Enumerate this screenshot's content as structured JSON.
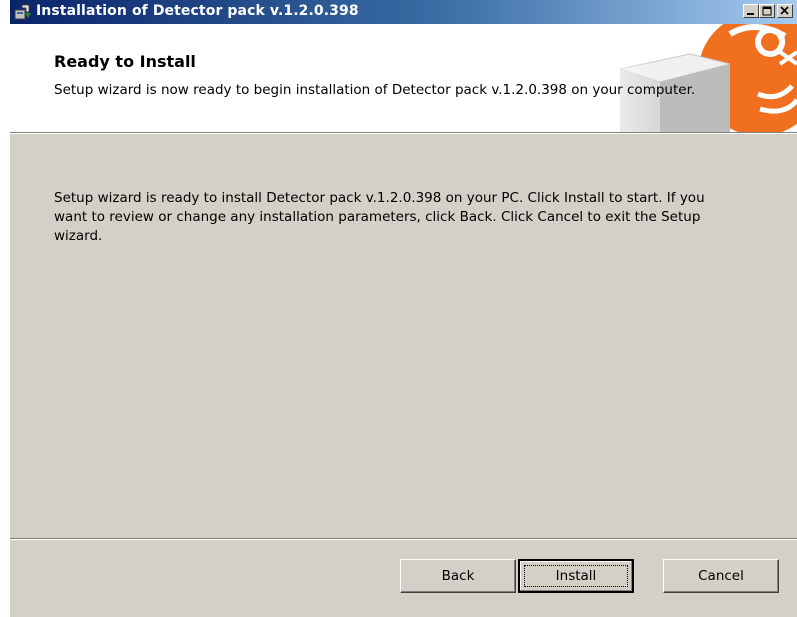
{
  "window": {
    "title": "Installation of Detector pack v.1.2.0.398",
    "icon": "installer-icon",
    "controls": {
      "minimize_icon": "minimize-icon",
      "maximize_icon": "maximize-icon",
      "close_icon": "close-icon"
    }
  },
  "header": {
    "title": "Ready to Install",
    "description": "Setup wizard is now ready to begin installation of Detector pack v.1.2.0.398 on your computer."
  },
  "body": {
    "text": "Setup wizard is ready to install Detector pack v.1.2.0.398 on your PC. Click Install to start. If you want to review or change any installation parameters, click Back. Click Cancel to exit the Setup wizard."
  },
  "buttons": {
    "back": "Back",
    "install": "Install",
    "cancel": "Cancel"
  },
  "colors": {
    "titlebar_start": "#0a246a",
    "titlebar_end": "#a6caf0",
    "dialog_bg": "#d4d0c8",
    "accent_orange": "#f07020"
  }
}
